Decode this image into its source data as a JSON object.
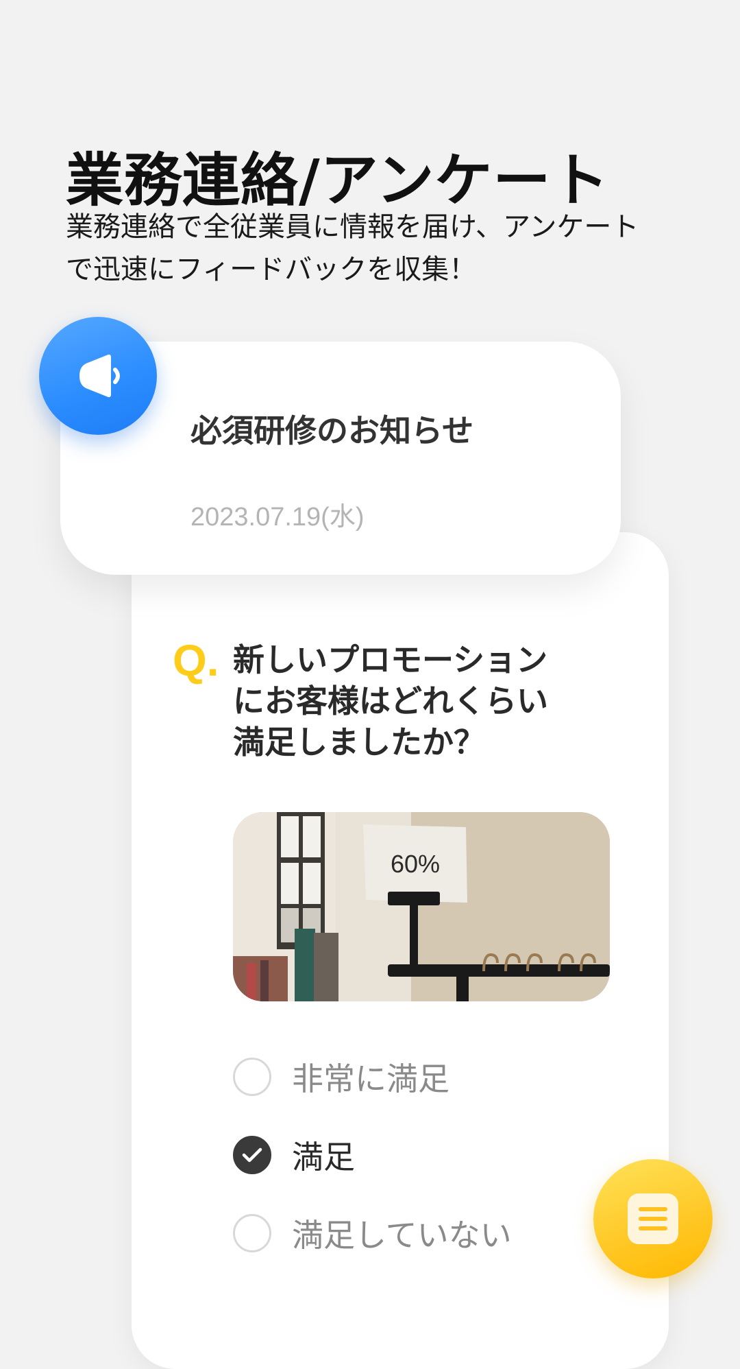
{
  "page": {
    "title": "業務連絡/アンケート",
    "description_lines": [
      "業務連絡で全従業員に情報を届け、アンケート",
      "で迅速にフィードバックを収集！"
    ]
  },
  "notice": {
    "icon": "megaphone-icon",
    "title": "必須研修のお知らせ",
    "date": "2023.07.19(水)"
  },
  "survey": {
    "q_mark": "Q",
    "question_lines": [
      "新しいプロモーション",
      "にお客様はどれくらい",
      "満足しましたか？"
    ],
    "image": {
      "sign_text": "60%"
    },
    "options": [
      {
        "label": "非常に満足",
        "checked": false
      },
      {
        "label": "満足",
        "checked": true
      },
      {
        "label": "満足していない",
        "checked": false
      }
    ]
  },
  "fab": {
    "icon": "list-document-icon"
  },
  "colors": {
    "background": "#f2f2f2",
    "accent_blue": "#2a8cff",
    "accent_yellow": "#ffc928",
    "q_mark": "#ffcc1a",
    "checked": "#3a3a3a"
  }
}
